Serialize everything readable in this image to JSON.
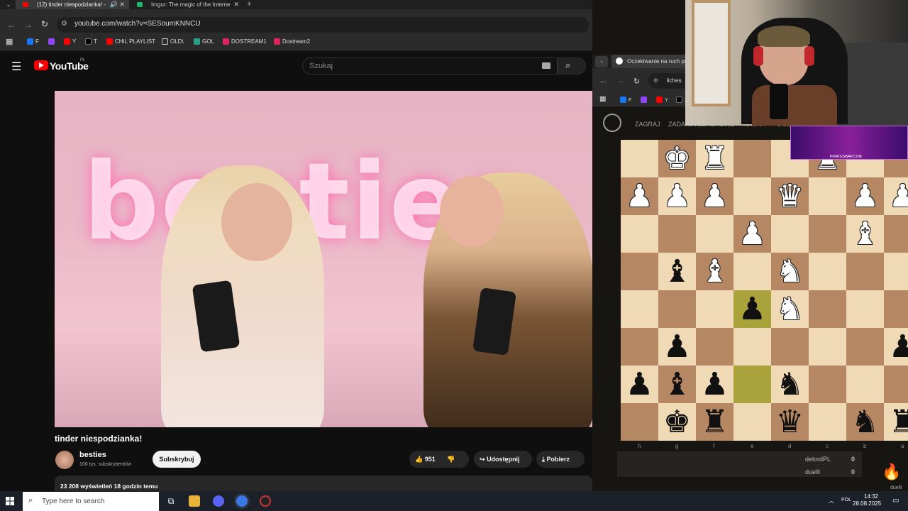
{
  "browser": {
    "tabs": [
      {
        "title": "(12) tinder niespodzianka! -",
        "active": true
      },
      {
        "title": "Imgur: The magic of the Interne",
        "active": false
      }
    ],
    "url": "youtube.com/watch?v=SESoumKNNCU",
    "bookmarks": [
      "F",
      "",
      "Y",
      "T",
      "CHIL PLAYLIST",
      "OLD\\",
      "GOL",
      "DOSTREAM1",
      "Dostream2"
    ]
  },
  "youtube": {
    "logo_text": "YouTube",
    "region": "PL",
    "search_placeholder": "Szukaj",
    "video_title": "tinder niespodzianka!",
    "neon_sign": "besties",
    "channel": {
      "name": "besties",
      "subscribers": "100 tys. subskrybentów"
    },
    "subscribe_label": "Subskrybuj",
    "likes": "951",
    "share_label": "Udostępnij",
    "download_label": "Pobierz",
    "views_line": "23 208 wyświetleń  18 godzin temu"
  },
  "lichess": {
    "tab_title": "Oczekiwanie na ruch pr",
    "url": "liches",
    "bookmarks": [
      "F",
      "",
      "Y",
      "X"
    ],
    "nav": [
      "ZAGRAJ",
      "ZADANIA SZACHOWE",
      "NAUKA",
      "OGL"
    ],
    "files": [
      "h",
      "g",
      "f",
      "e",
      "d",
      "c",
      "b",
      "a"
    ],
    "board": [
      [
        "",
        "wK",
        "wR",
        "",
        "",
        "wR",
        "",
        ""
      ],
      [
        "wP",
        "wP",
        "wP",
        "",
        "wQ",
        "",
        "wP",
        "wP"
      ],
      [
        "",
        "",
        "",
        "wP",
        "",
        "",
        "wB",
        ""
      ],
      [
        "",
        "bB",
        "wB",
        "",
        "wN",
        "",
        "",
        ""
      ],
      [
        "",
        "",
        "",
        "bP",
        "wN",
        "",
        "",
        ""
      ],
      [
        "",
        "bP",
        "",
        "",
        "",
        "",
        "",
        "bP"
      ],
      [
        "bP",
        "bB",
        "bP",
        "",
        "bN",
        "",
        "",
        ""
      ],
      [
        "",
        "bK",
        "bR",
        "",
        "bQ",
        "",
        "bN",
        "bR"
      ]
    ],
    "highlights": [
      "4-3",
      "6-3"
    ],
    "players": [
      {
        "name": "delordPL",
        "score": "0"
      },
      {
        "name": "duelli",
        "score": "0"
      }
    ],
    "side_tag": "duelli"
  },
  "stream": {
    "banner_text": "PIRATESWAP.COM"
  },
  "taskbar": {
    "search_placeholder": "Type here to search",
    "lang": "POL",
    "time": "14:32",
    "date": "28.08.2025"
  },
  "colors": {
    "yt_red": "#ff0000",
    "board_light": "#f0d9b5",
    "board_dark": "#b58863",
    "last_move": "#aaa23a"
  }
}
